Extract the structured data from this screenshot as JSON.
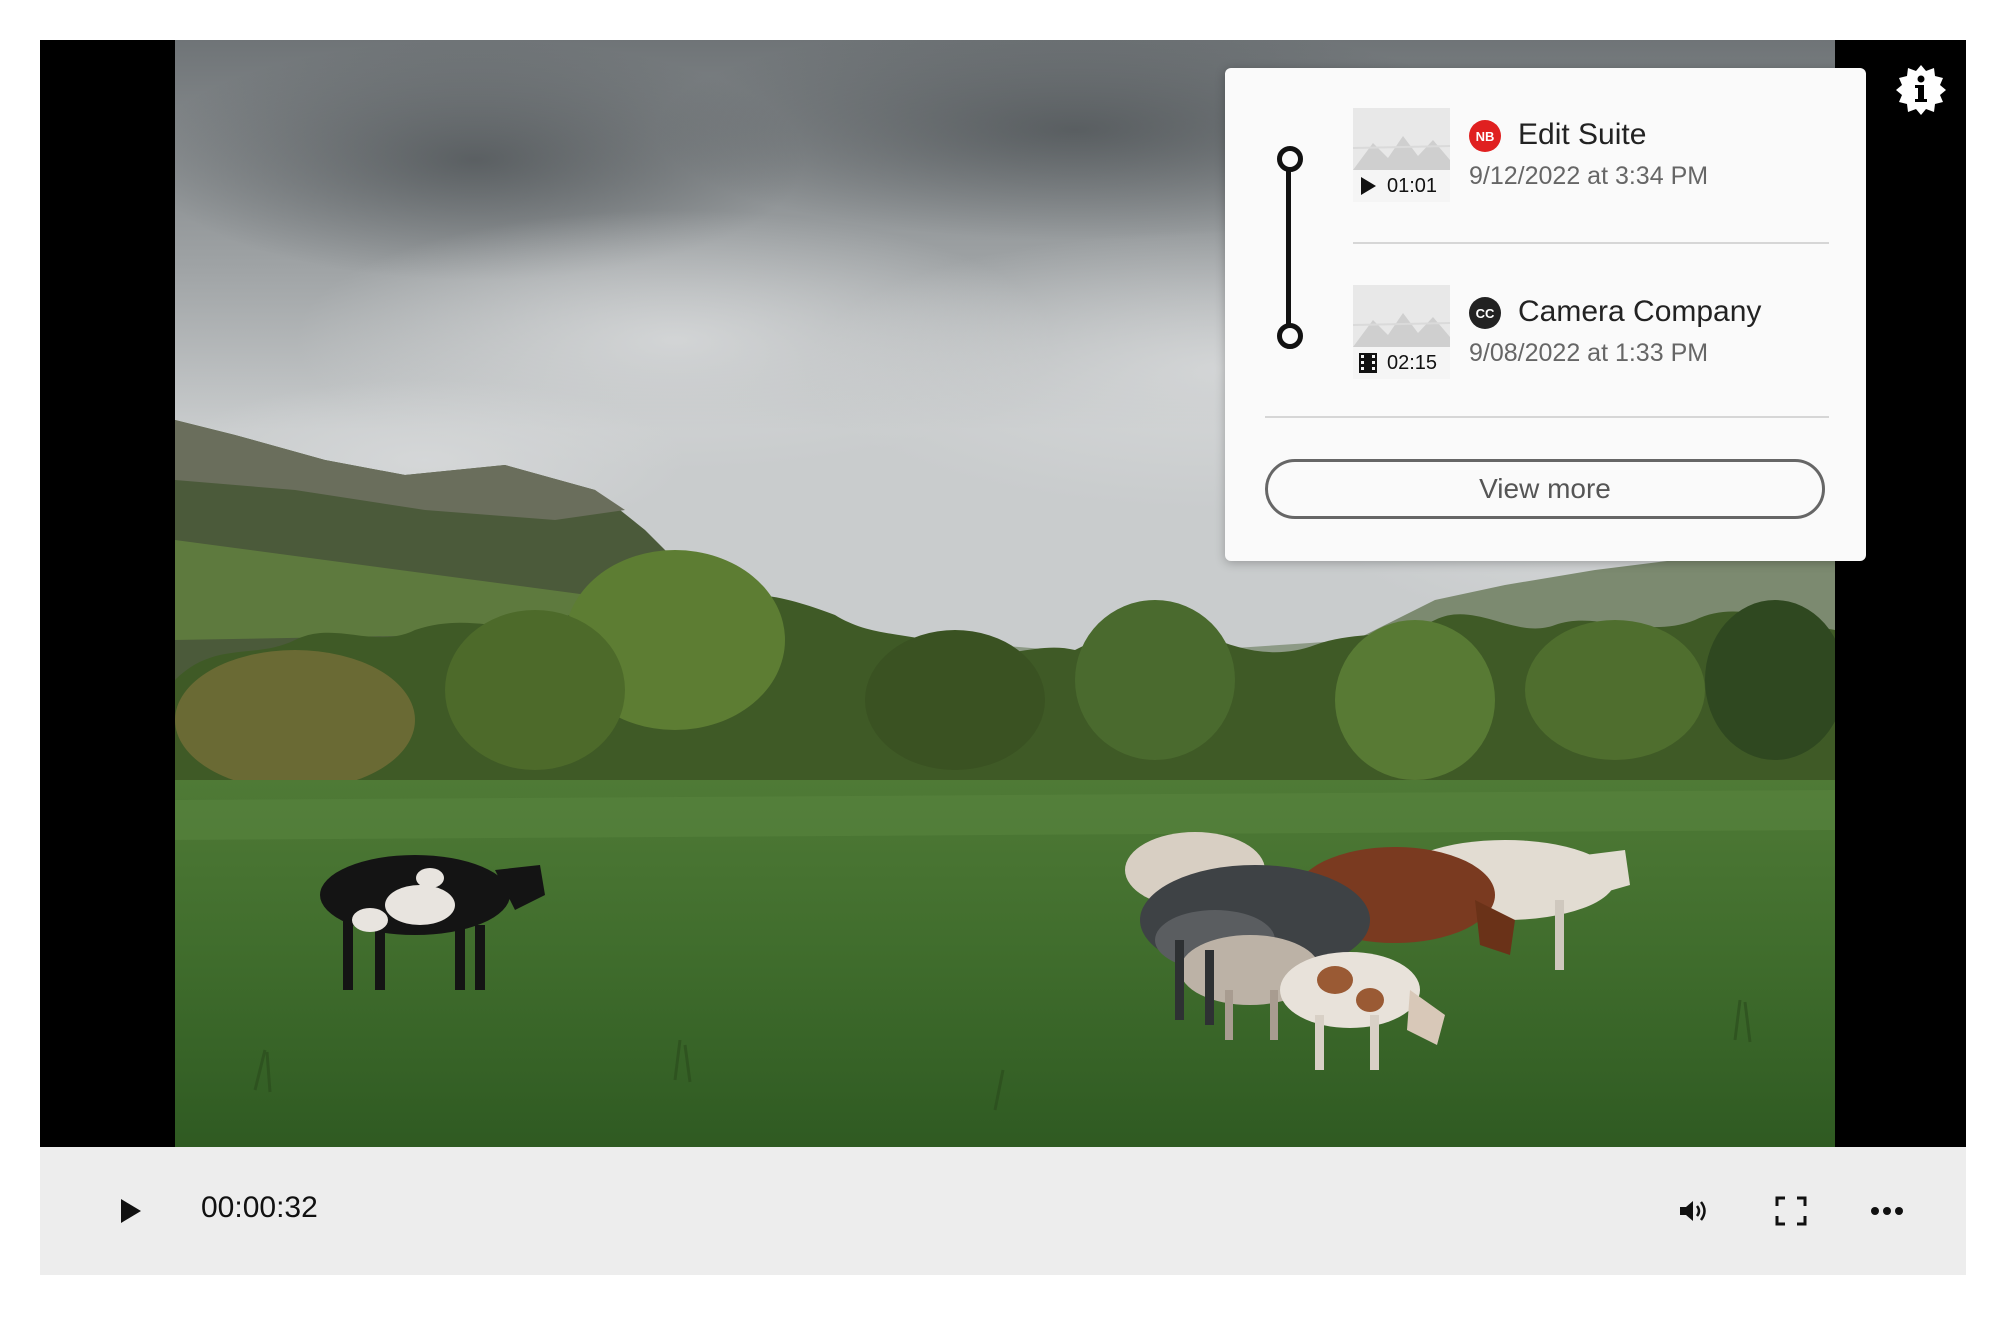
{
  "video": {
    "frame_description_icon": "landscape-with-cows"
  },
  "info_button": {
    "icon": "info-badge-icon"
  },
  "version_history": {
    "versions": [
      {
        "thumb_icon": "play-icon",
        "duration": "01:01",
        "source_badge": "NB",
        "source_badge_color": "#e02020",
        "name": "Edit Suite",
        "date": "9/12/2022 at 3:34 PM"
      },
      {
        "thumb_icon": "film-icon",
        "duration": "02:15",
        "source_badge": "CC",
        "source_badge_color": "#222222",
        "name": "Camera Company",
        "date": "9/08/2022 at 1:33 PM"
      }
    ],
    "view_more_label": "View more"
  },
  "controls": {
    "play_icon": "play-icon",
    "current_time": "00:00:32",
    "volume_icon": "volume-icon",
    "fullscreen_icon": "fullscreen-icon",
    "more_icon": "more-icon"
  }
}
